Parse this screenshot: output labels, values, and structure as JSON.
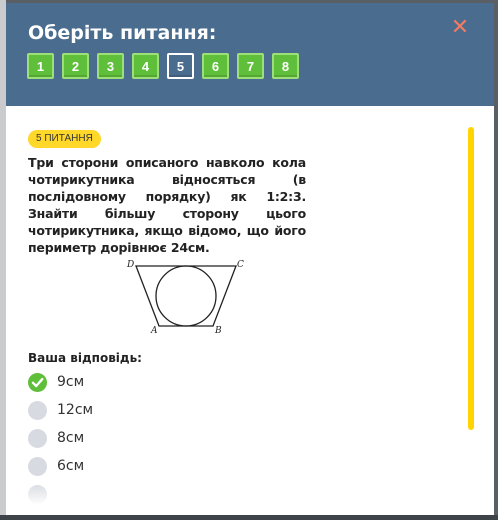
{
  "header": {
    "title": "Оберіть питання:",
    "close_symbol": "✕"
  },
  "question_nav": [
    "1",
    "2",
    "3",
    "4",
    "5",
    "6",
    "7",
    "8"
  ],
  "active_question": "5",
  "question": {
    "badge": "5 ПИТАННЯ",
    "text": "Три сторони описаного навколо кола чотирикутника відносяться (в послідовному порядку) як 1:2:3. Знайти більшу сторону цього чотирикутника, якщо відомо, що його периметр дорівнює 24см.",
    "figure_labels": {
      "A": "A",
      "B": "B",
      "C": "C",
      "D": "D"
    }
  },
  "answer_label": "Ваша відповідь:",
  "options": [
    {
      "text": "9см",
      "checked": true
    },
    {
      "text": "12см",
      "checked": false
    },
    {
      "text": "8см",
      "checked": false
    },
    {
      "text": "6см",
      "checked": false
    }
  ],
  "colors": {
    "header": "#4a6d8f",
    "accent_green": "#5fbf3a",
    "badge_yellow": "#ffd82a",
    "close": "#f07a63"
  }
}
